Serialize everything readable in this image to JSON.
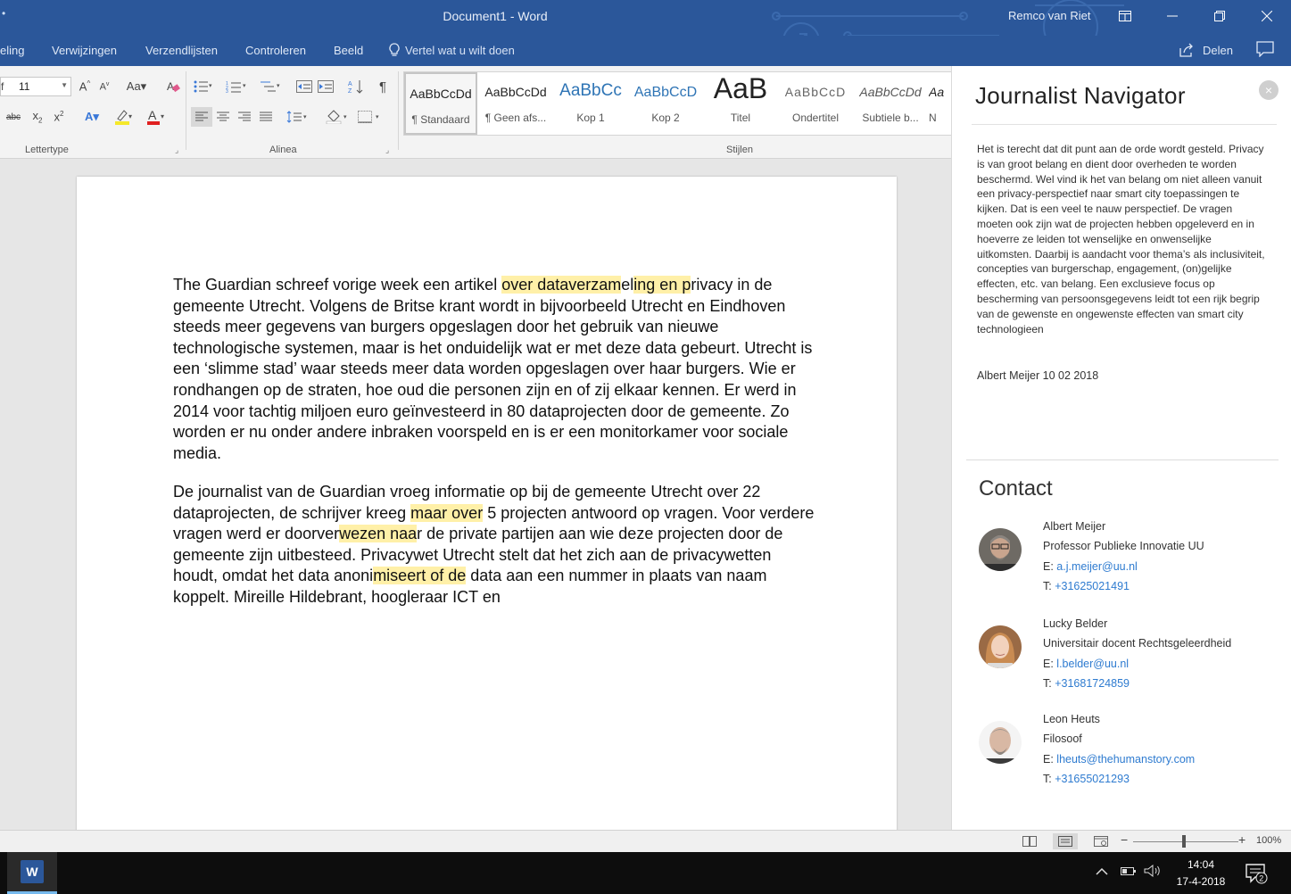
{
  "titlebar": {
    "dot": "•",
    "title": "Document1  -  Word",
    "user": "Remco van Riet"
  },
  "tabs": {
    "items": [
      "eling",
      "Verwijzingen",
      "Verzendlijsten",
      "Controleren",
      "Beeld"
    ],
    "tell_me": "Vertel wat u wilt doen",
    "share": "Delen"
  },
  "ribbon": {
    "font_name": "f",
    "font_size": "11",
    "groups": {
      "font": "Lettertype",
      "paragraph": "Alinea",
      "styles": "Stijlen"
    },
    "styles": [
      {
        "sample": "AaBbCcDd",
        "name": "¶ Standaard"
      },
      {
        "sample": "AaBbCcDd",
        "name": "¶ Geen afs..."
      },
      {
        "sample": "AaBbCc",
        "name": "Kop 1"
      },
      {
        "sample": "AaBbCcD",
        "name": "Kop 2"
      },
      {
        "sample": "AaB",
        "name": "Titel"
      },
      {
        "sample": "AaBbCcD",
        "name": "Ondertitel"
      },
      {
        "sample": "AaBbCcDd",
        "name": "Subtiele b..."
      },
      {
        "sample": "Aa",
        "name": "N"
      }
    ]
  },
  "document": {
    "p1": {
      "a": "The Guardian schreef vorige week een artikel ",
      "hl1": "over dataverzam",
      "b": "el",
      "hl2": "ing en p",
      "c": "rivacy in de gemeente Utrecht. Volgens de Britse krant wordt in bijvoorbeeld Utrecht en Eindhoven steeds meer gegevens van burgers opgeslagen door het gebruik van nieuwe technologische systemen, maar is het onduidelijk wat er met deze data gebeurt. Utrecht is een ‘slimme stad’ waar steeds meer data worden opgeslagen over haar burgers. Wie er rondhangen op de straten, hoe oud die personen zijn en of zij elkaar kennen. Er werd in 2014 voor tachtig miljoen euro geïnvesteerd in 80 dataprojecten door de gemeente. Zo worden er nu onder andere inbraken voorspeld en is er een monitorkamer voor sociale media."
    },
    "p2": {
      "a": "De journalist van de Guardian vroeg informatie op bij de gemeente Utrecht over 22 dataprojecten, de schrijver kreeg ",
      "hl1": "maar over",
      "b": " 5 projecten antwoord op vragen. Voor verdere vragen werd er doorver",
      "hl2": "wezen naa",
      "c": "r de private partijen aan wie deze projecten door de gemeente zijn uitbesteed. Privacywet Utrecht stelt dat het zich aan de privacywetten houdt, omdat het data anoni",
      "hl3": "miseert of de",
      "d": " data aan een nummer in plaats van naam koppelt. Mireille Hildebrant, hoogleraar ICT en"
    }
  },
  "navigator": {
    "title": "Journalist Navigator",
    "close": "×",
    "body": "Het is terecht dat dit punt aan de orde wordt gesteld. Privacy is van groot belang en dient door overheden te worden beschermd. Wel vind ik het van belang om niet alleen vanuit een privacy-perspectief naar smart city toepassingen te kijken. Dat is een veel te nauw perspectief. De vragen moeten ook zijn wat de projecten hebben opgeleverd en in hoeverre ze leiden tot wenselijke en onwenselijke uitkomsten. Daarbij is aandacht voor thema’s als inclusiviteit, concepties van burgerschap, engagement, (on)gelijke effecten, etc. van belang. Een exclusieve focus op bescherming van persoonsgegevens leidt tot een rijk begrip van de gewenste en ongewenste effecten van smart city technologieen",
    "signature": "Albert Meijer 10 02 2018",
    "contact_heading": "Contact",
    "contacts": [
      {
        "name": "Albert Meijer",
        "role": "Professor Publieke Innovatie UU",
        "email_label": "E:",
        "email": "a.j.meijer@uu.nl",
        "phone_label": "T:",
        "phone": "+31625021491"
      },
      {
        "name": "Lucky Belder",
        "role": "Universitair docent Rechtsgeleerdheid",
        "email_label": "E:",
        "email": "l.belder@uu.nl",
        "phone_label": "T:",
        "phone": "+31681724859"
      },
      {
        "name": "Leon Heuts",
        "role": "Filosoof",
        "email_label": "E:",
        "email": "lheuts@thehumanstory.com",
        "phone_label": "T:",
        "phone": "+31655021293"
      }
    ]
  },
  "statusbar": {
    "zoom": "100%",
    "zoom_level_percent": 100
  },
  "taskbar": {
    "app_label": "W",
    "time": "14:04",
    "date": "17-4-2018",
    "notification_count": "2"
  },
  "colors": {
    "word_blue": "#2b579a",
    "highlight": "#fff0a8",
    "link": "#2e7bd0"
  }
}
